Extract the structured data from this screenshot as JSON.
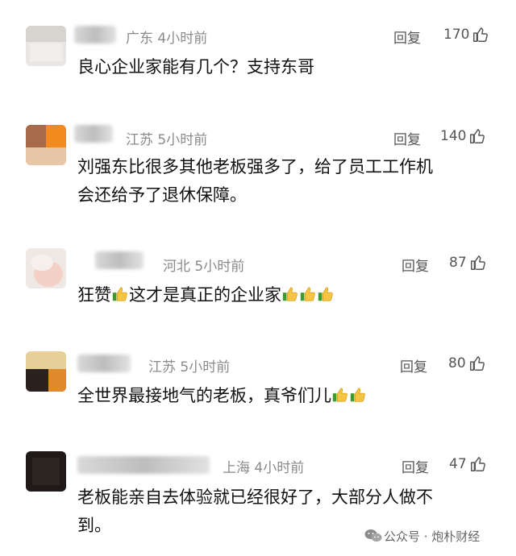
{
  "comments": [
    {
      "region": "广东",
      "time": "4小时前",
      "reply_label": "回复",
      "likes": "170",
      "text": "良心企业家能有几个？支持东哥"
    },
    {
      "region": "江苏",
      "time": "5小时前",
      "reply_label": "回复",
      "likes": "140",
      "text_line1": "刘强东比很多其他老板强多了，给了员工工作机",
      "text_line2": "会还给予了退休保障。"
    },
    {
      "region": "河北",
      "time": "5小时前",
      "reply_label": "回复",
      "likes": "87",
      "text_part1": "狂赞",
      "text_part2": "这才是真正的企业家"
    },
    {
      "region": "江苏",
      "time": "5小时前",
      "reply_label": "回复",
      "likes": "80",
      "text": "全世界最接地气的老板，真爷们儿"
    },
    {
      "region": "上海",
      "time": "4小时前",
      "reply_label": "回复",
      "likes": "47",
      "text_line1": "老板能亲自去体验就已经很好了，大部分人做不",
      "text_line2": "到。"
    }
  ],
  "watermark": {
    "label": "公众号 · 炮朴财经"
  },
  "icons": {
    "like": "thumbs-up-outline-icon",
    "emoji": "thumbs-up-emoji-icon"
  }
}
